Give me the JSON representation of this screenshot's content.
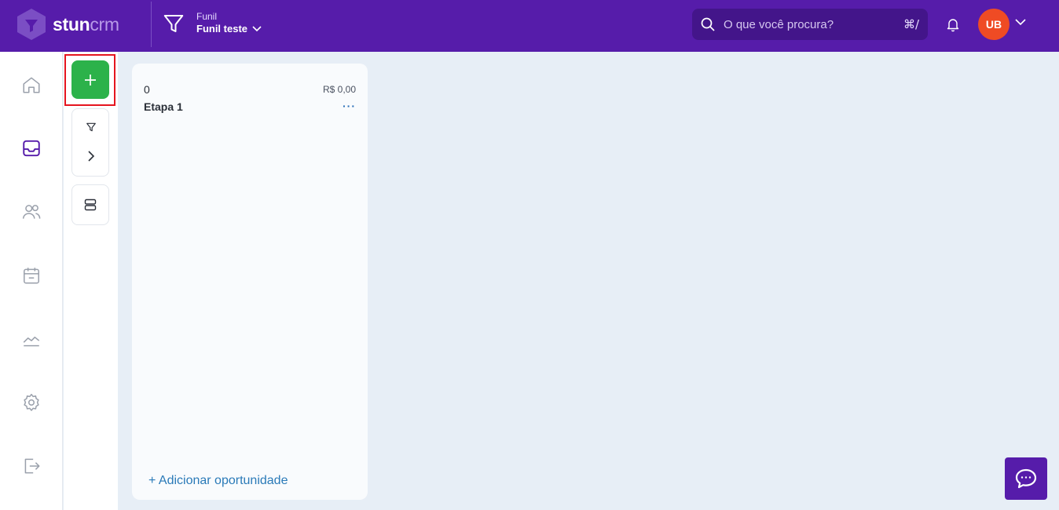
{
  "header": {
    "logo_primary": "stun",
    "logo_secondary": "crm",
    "funnel_label": "Funil",
    "funnel_name": "Funil teste",
    "search_placeholder": "O que você procura?",
    "search_shortcut": "⌘/",
    "avatar_initials": "UB"
  },
  "nav": {
    "items": [
      "home-icon",
      "inbox-icon",
      "users-icon",
      "calendar-icon",
      "chart-icon",
      "settings-icon",
      "logout-icon"
    ]
  },
  "toolbar": {
    "add_icon": "plus-icon",
    "filter_icon": "filter-icon",
    "expand_icon": "chevron-right-icon",
    "layout_icon": "layout-icon"
  },
  "column": {
    "count": "0",
    "total": "R$ 0,00",
    "title": "Etapa 1",
    "more": "···",
    "add_label": "+ Adicionar oportunidade"
  },
  "colors": {
    "brand": "#561caa",
    "accent_green": "#2cb24a",
    "avatar_bg": "#ef4b24",
    "link": "#2a7ab8"
  }
}
